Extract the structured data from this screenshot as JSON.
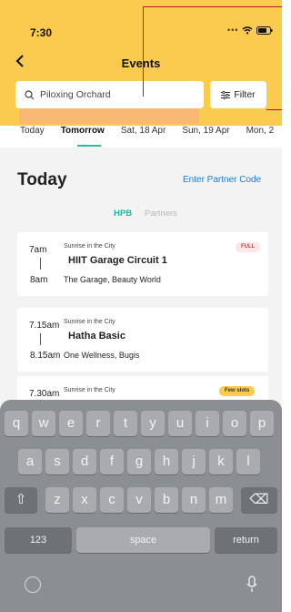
{
  "status": {
    "time": "7:30"
  },
  "header": {
    "title": "Events",
    "search_value": "Piloxing Orchard",
    "filter_label": "Filter"
  },
  "date_tabs": [
    "Today",
    "Tomorrow",
    "Sat, 18 Apr",
    "Sun, 19 Apr",
    "Mon, 2"
  ],
  "main": {
    "section_title": "Today",
    "partner_code_link": "Enter Partner Code",
    "segments": [
      "HPB",
      "Partners"
    ],
    "events": [
      {
        "start": "7am",
        "end": "8am",
        "series": "Sunrise in the City",
        "title": "HIIT Garage Circuit 1",
        "venue": "The Garage, Beauty World",
        "badge": "FULL"
      },
      {
        "start": "7.15am",
        "end": "8.15am",
        "series": "Sunrise in the City",
        "title": "Hatha Basic",
        "venue": "One Wellness, Bugis",
        "badge": ""
      },
      {
        "start": "7.30am",
        "end": "",
        "series": "Sunrise in the City",
        "title": "",
        "venue": "",
        "badge": "Few slots"
      }
    ]
  },
  "keyboard": {
    "row1": [
      "q",
      "w",
      "e",
      "r",
      "t",
      "y",
      "u",
      "i",
      "o",
      "p"
    ],
    "row2": [
      "a",
      "s",
      "d",
      "f",
      "g",
      "h",
      "j",
      "k",
      "l"
    ],
    "row3": [
      "z",
      "x",
      "c",
      "v",
      "b",
      "n",
      "m"
    ],
    "shift": "⇧",
    "delete": "⌫",
    "numbers_label": "123",
    "space_label": "space",
    "return_label": "return"
  },
  "colors": {
    "header": "#FBCB4F",
    "accent_teal": "#21BFAA",
    "link_blue": "#1C7CC8",
    "annotation_red": "#C0142A"
  }
}
